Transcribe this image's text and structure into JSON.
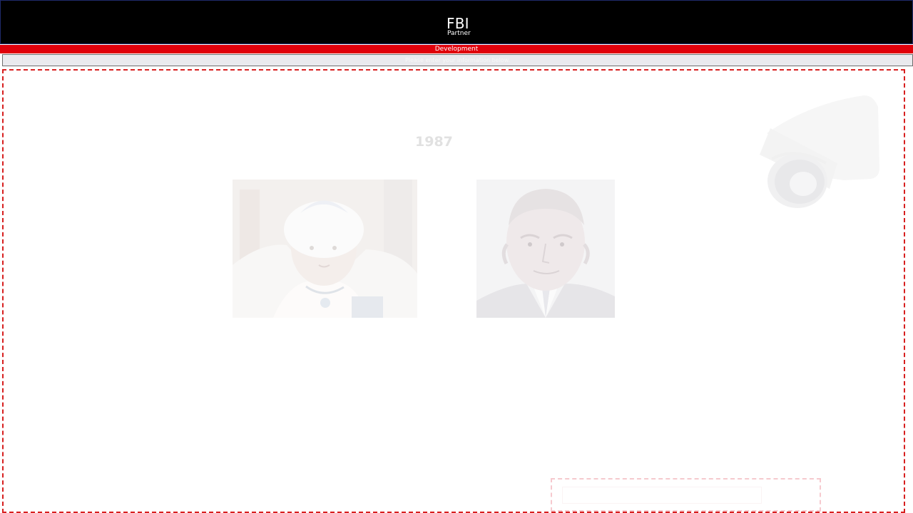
{
  "header": {
    "title": "FBI",
    "subtitle": "Partner"
  },
  "environment": {
    "label": "Development",
    "color": "#e0000b"
  },
  "notice": {
    "text": "Please enter your information below."
  },
  "stage": {
    "year": "1987",
    "border_color": "#d71f1f",
    "images": [
      {
        "name": "portrait-woman-tiara"
      },
      {
        "name": "portrait-man-suit"
      }
    ],
    "decoration": {
      "name": "security-camera-icon"
    }
  },
  "colors": {
    "header_bg": "#000000",
    "header_text": "#ffffff",
    "env_bar": "#e0000b",
    "notice_bg": "#eaeaee",
    "year_text": "#e1e1e1"
  }
}
